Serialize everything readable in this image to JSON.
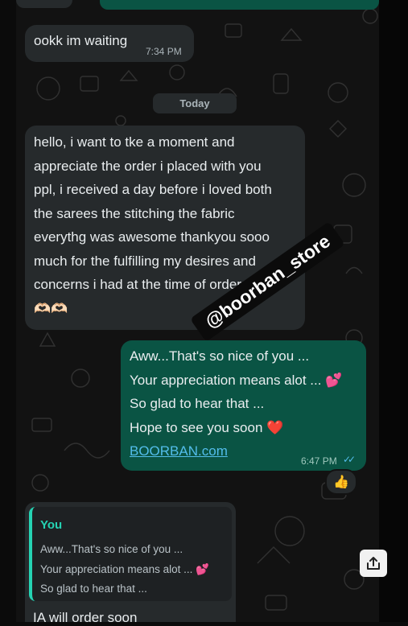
{
  "chat": {
    "msg_waiting": {
      "text": "ookk im waiting",
      "time": "7:34 PM"
    },
    "date_divider": "Today",
    "msg_appreciation": {
      "text": "hello, i want to tke a moment and\nappreciate the order i placed with you\nppl, i received a day before i loved both\nthe sarees the stitching the fabric\neverythg was awesome thankyou sooo\nmuch for the fulfilling my desires and\nconcerns i had at the time of order...",
      "emoji_thumb": "👍🏻",
      "emoji_hearts": "🫶🏻🫶🏻"
    },
    "msg_reply": {
      "line1": "Aww...That's so nice of you ...",
      "line2": "Your appreciation means alot ...",
      "line2_emoji": "💕",
      "line3": "So glad to hear that ...",
      "line4": "Hope to see you soon",
      "line4_emoji": "❤️",
      "link": "BOORBAN.com",
      "time": "6:47 PM",
      "ticks": "✓✓",
      "reaction": "👍"
    },
    "quoted": {
      "author": "You",
      "line1": "Aww...That's so nice of you ...",
      "line2": "Your appreciation means alot ...",
      "line2_emoji": "💕",
      "line3": "So glad to hear that ..."
    },
    "reply_text": "IA will order soon"
  },
  "watermark": "@boorban_store",
  "colors": {
    "incoming_bubble": "#262a2c",
    "outgoing_bubble": "#0a5444",
    "quote_accent": "#25d3b3",
    "link": "#53bdeb",
    "read_ticks": "#53bdeb"
  },
  "icons": {
    "share": "share-icon"
  }
}
